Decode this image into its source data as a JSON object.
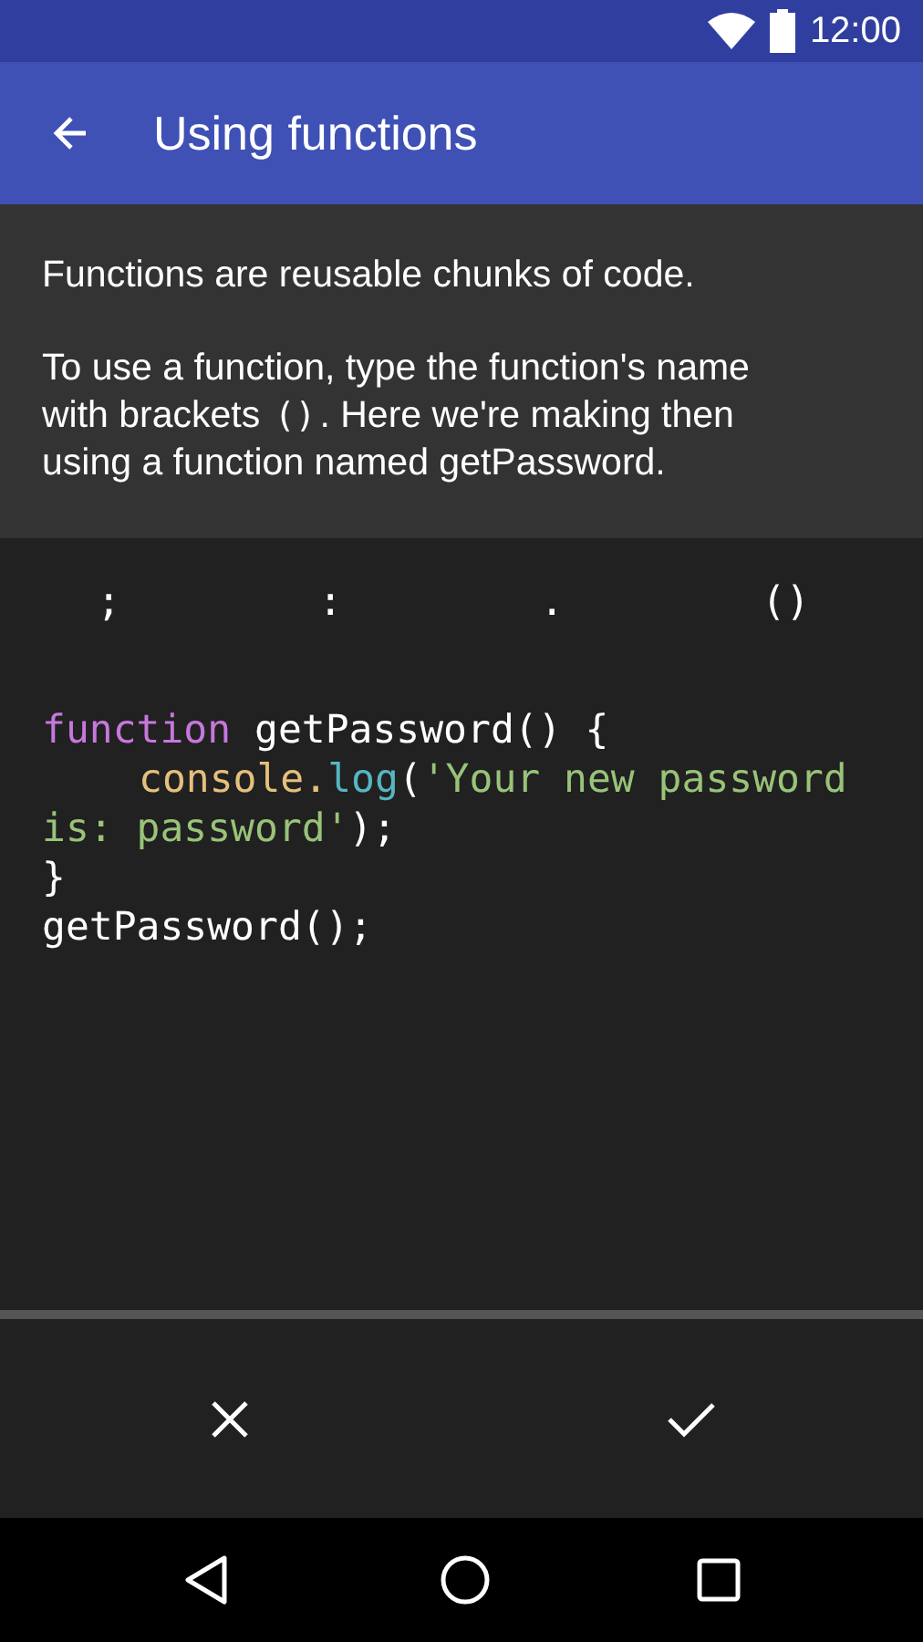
{
  "status_bar": {
    "time": "12:00"
  },
  "app_bar": {
    "title": "Using functions"
  },
  "description": {
    "paragraphs": [
      [
        {
          "kind": "text",
          "text": "Functions are reusable chunks of code."
        }
      ],
      [
        {
          "kind": "text",
          "text": "To use a function, type the function's name with brackets "
        },
        {
          "kind": "code",
          "text": "()"
        },
        {
          "kind": "text",
          "text": ". Here we're making then using a function named getPassword."
        }
      ]
    ]
  },
  "symbol_keys": [
    ";",
    ":",
    ".",
    "()"
  ],
  "code": [
    [
      {
        "kind": "keyword",
        "text": "function"
      },
      {
        "kind": "plain",
        "text": " getPassword() {"
      }
    ],
    [
      {
        "kind": "object",
        "text": "console.",
        "indent": true
      },
      {
        "kind": "method",
        "text": "log"
      },
      {
        "kind": "plain",
        "text": "("
      },
      {
        "kind": "string",
        "text": "'Your new password"
      }
    ],
    [
      {
        "kind": "string",
        "text": "is: password'"
      },
      {
        "kind": "plain",
        "text": ");"
      }
    ],
    [
      {
        "kind": "plain",
        "text": "}"
      }
    ],
    [
      {
        "kind": "plain",
        "text": "getPassword();"
      }
    ]
  ]
}
